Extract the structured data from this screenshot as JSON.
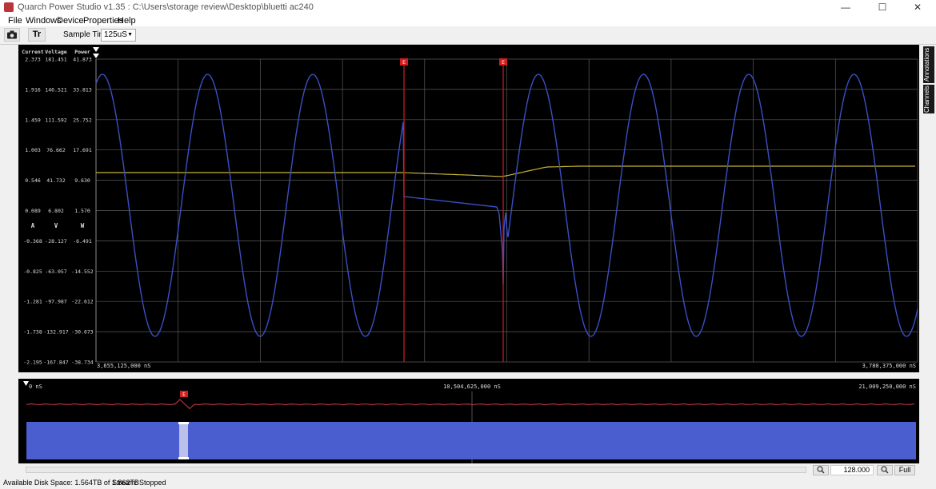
{
  "window": {
    "title": "Quarch Power Studio v1.35 : C:\\Users\\storage review\\Desktop\\bluetti ac240",
    "minimize": "—",
    "maximize": "☐",
    "close": "✕"
  },
  "menu": [
    "File",
    "Windows",
    "Device",
    "Properties",
    "Help"
  ],
  "toolbar": {
    "camera_icon": "camera-icon",
    "text_toggle_label": "Tr",
    "sample_time_label": "Sample Time:",
    "sample_time_value": "125uS"
  },
  "axes": {
    "headers": [
      "Current",
      "Voltage",
      "Power"
    ],
    "current_ticks": [
      "2.373",
      "1.916",
      "1.459",
      "1.003",
      "0.546",
      "0.089",
      "-0.368",
      "-0.825",
      "-1.281",
      "-1.738",
      "-2.195"
    ],
    "voltage_ticks": [
      "181.451",
      "146.521",
      "111.592",
      "76.662",
      "41.732",
      "6.802",
      "-28.127",
      "-63.057",
      "-97.987",
      "-132.917",
      "-167.847"
    ],
    "power_ticks": [
      "41.873",
      "33.813",
      "25.752",
      "17.691",
      "9.630",
      "1.570",
      "-6.491",
      "-14.552",
      "-22.612",
      "-30.673",
      "-38.734"
    ],
    "units": [
      "A",
      "V",
      "W"
    ],
    "x_start": "3,655,125,000 nS",
    "x_end": "3,780,375,000 nS"
  },
  "markers": {
    "flag_label": "E"
  },
  "overview": {
    "labels": [
      "0 nS",
      "10,504,625,000 nS",
      "21,009,250,000 nS"
    ]
  },
  "right_tabs": [
    "Annotations",
    "Channels"
  ],
  "zoom": {
    "zoom_in_icon": "zoom-in-icon",
    "value": "128.000",
    "zoom_out_icon": "zoom-out-icon",
    "full_label": "Full"
  },
  "status": {
    "disk": "Available Disk Space: 1.564TB of 1.862TB",
    "stream": "Stream:  Stopped"
  },
  "colors": {
    "plot_bg": "#000000",
    "grid": "#5a5a5a",
    "current_trace": "#3a4fc4",
    "power_trace": "#c8b437",
    "marker": "#d21e1e",
    "overview_fill": "#4a5ed0",
    "overview_line": "#b03040",
    "menubar_accent": "#1f3f66"
  }
}
